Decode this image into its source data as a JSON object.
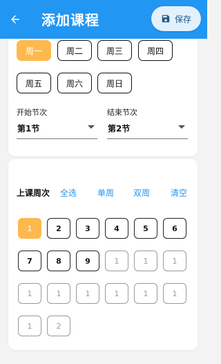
{
  "header": {
    "title": "添加课程",
    "save_label": "保存",
    "accent_color": "#2196f3",
    "back_icon": "arrow-left-icon",
    "save_icon": "floppy-disk-icon"
  },
  "days": {
    "selected": "周一",
    "items": [
      "周一",
      "周二",
      "周三",
      "周四",
      "周五",
      "周六",
      "周日"
    ]
  },
  "period": {
    "start_label": "开始节次",
    "start_value": "第1节",
    "end_label": "结束节次",
    "end_value": "第2节"
  },
  "weeks": {
    "title": "上课周次",
    "actions": [
      "全选",
      "单周",
      "双周",
      "清空"
    ],
    "highlight_color": "#fdb94e",
    "items": [
      {
        "label": "1",
        "state": "selected"
      },
      {
        "label": "2",
        "state": "normal"
      },
      {
        "label": "3",
        "state": "normal"
      },
      {
        "label": "4",
        "state": "normal"
      },
      {
        "label": "5",
        "state": "normal"
      },
      {
        "label": "6",
        "state": "normal"
      },
      {
        "label": "7",
        "state": "normal"
      },
      {
        "label": "8",
        "state": "normal"
      },
      {
        "label": "9",
        "state": "normal"
      },
      {
        "label": "1",
        "state": "disabled"
      },
      {
        "label": "1",
        "state": "disabled"
      },
      {
        "label": "1",
        "state": "disabled"
      },
      {
        "label": "1",
        "state": "disabled"
      },
      {
        "label": "1",
        "state": "disabled"
      },
      {
        "label": "1",
        "state": "disabled"
      },
      {
        "label": "1",
        "state": "disabled"
      },
      {
        "label": "1",
        "state": "disabled"
      },
      {
        "label": "1",
        "state": "disabled"
      },
      {
        "label": "1",
        "state": "disabled"
      },
      {
        "label": "2",
        "state": "disabled"
      }
    ]
  }
}
